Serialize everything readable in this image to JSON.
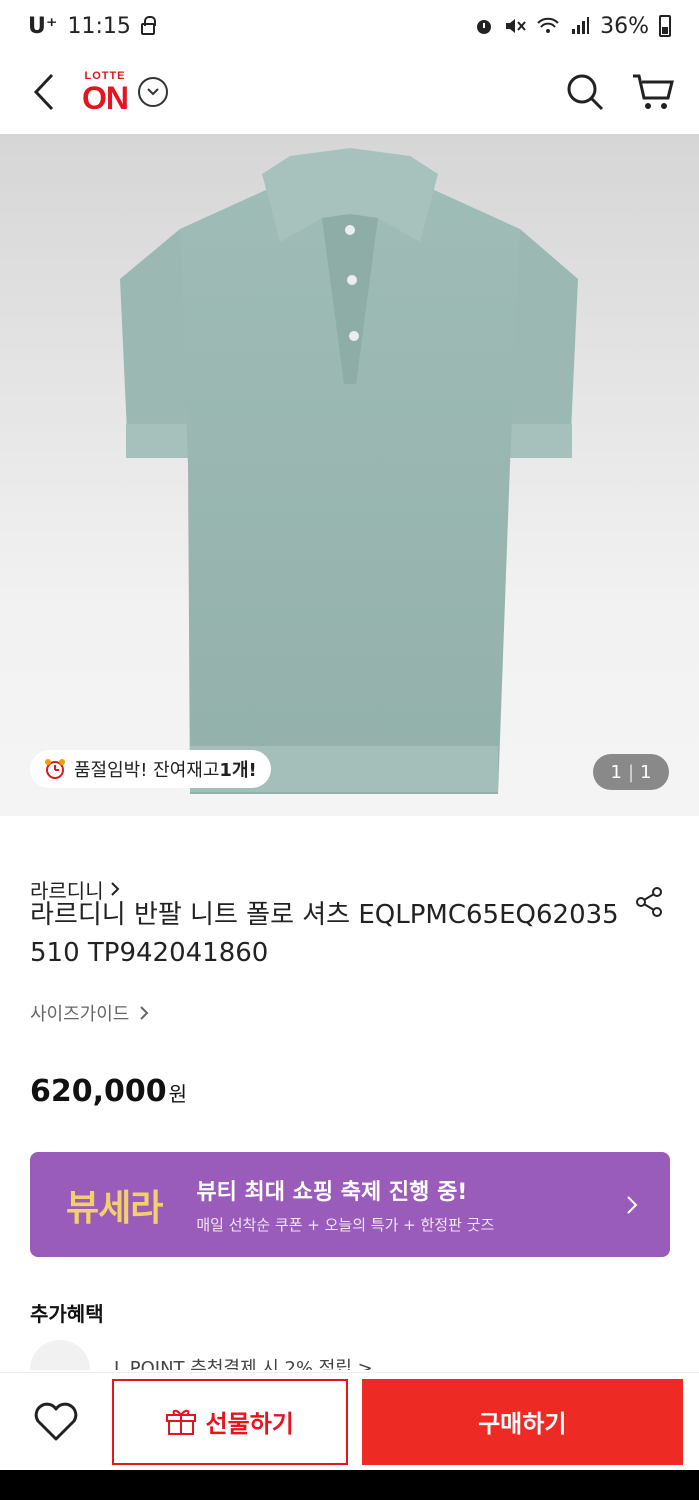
{
  "status_bar": {
    "carrier": "U⁺",
    "time": "11:15",
    "battery": "36%"
  },
  "header": {
    "logo_top": "LOTTE",
    "logo_main": "ON"
  },
  "product_image": {
    "stock_badge_prefix": "품절임박! 잔여재고 ",
    "stock_badge_count": "1개!",
    "page_current": "1",
    "page_total": "1"
  },
  "product": {
    "brand": "라르디니",
    "title": "라르디니 반팔 니트 폴로 셔츠 EQLPMC65EQ62035 510 TP942041860",
    "size_guide": "사이즈가이드",
    "price": "620,000",
    "price_unit": "원"
  },
  "banner": {
    "logo": "뷰세라",
    "title": "뷰티 최대 쇼핑 축제 진행 중!",
    "subtitle": "매일 선착순 쿠폰 + 오늘의 특가 + 한정판 굿즈",
    "bg_color": "#9a5cba"
  },
  "benefits": {
    "title": "추가혜택",
    "first_item": "L.POINT 추천결제 시 2% 적립 >"
  },
  "bottom_bar": {
    "gift_label": "선물하기",
    "buy_label": "구매하기"
  },
  "colors": {
    "accent": "#e5141e",
    "buy": "#ee2a24"
  }
}
